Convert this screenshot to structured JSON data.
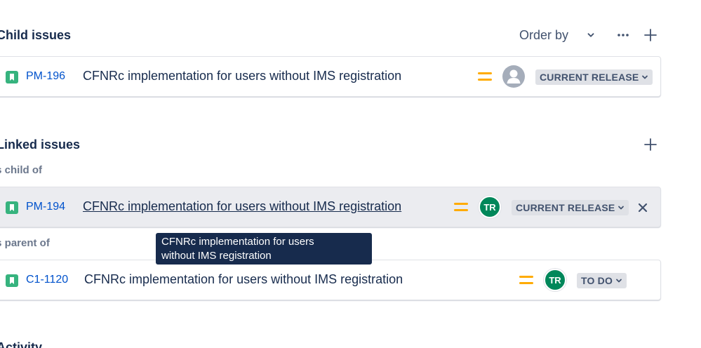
{
  "child_issues": {
    "title": "Child issues",
    "order_by_label": "Order by",
    "items": [
      {
        "key": "PM-196",
        "summary": "CFNRc implementation for users without IMS registration",
        "status": "CURRENT RELEASE",
        "assignee": ""
      }
    ]
  },
  "linked_issues": {
    "title": "Linked issues",
    "groups": [
      {
        "label": "is child of",
        "items": [
          {
            "key": "PM-194",
            "summary": "CFNRc implementation for users without IMS registration",
            "status": "CURRENT RELEASE",
            "assignee": "TR"
          }
        ]
      },
      {
        "label": "is parent of",
        "items": [
          {
            "key": "C1-1120",
            "summary": "CFNRc implementation for users without IMS registration",
            "status": "TO DO",
            "assignee": "TR"
          }
        ]
      }
    ]
  },
  "tooltip": {
    "line1": "CFNRc implementation for users",
    "line2": "without IMS registration"
  },
  "activity": {
    "title": "Activity"
  },
  "colors": {
    "story_icon": "#36b37e",
    "issue_key": "#0052cc",
    "priority_medium": "#ffab00",
    "avatar_tr": "#00875a",
    "lozenge_bg": "#dfe1e6",
    "tooltip_bg": "#172b4d"
  },
  "icons": {
    "issue_type": "story-bookmark-icon",
    "priority": "priority-medium-icon",
    "more": "more-horizontal-icon",
    "add": "plus-icon",
    "chevron": "chevron-down-icon",
    "unlink": "close-icon",
    "default_avatar": "user-avatar-icon"
  }
}
